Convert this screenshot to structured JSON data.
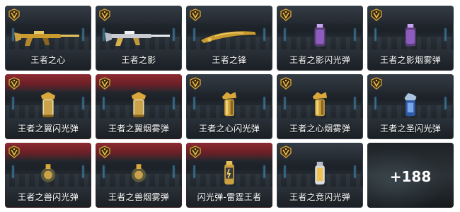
{
  "items": [
    {
      "name": "王者之心",
      "header": "gray",
      "art": "rifle"
    },
    {
      "name": "王者之影",
      "header": "gray",
      "art": "rifle-silver"
    },
    {
      "name": "王者之锋",
      "header": "gray",
      "art": "blade"
    },
    {
      "name": "王者之影闪光弹",
      "header": "gray",
      "art": "grenade-purple"
    },
    {
      "name": "王者之影烟雾弹",
      "header": "gray",
      "art": "grenade-purple"
    },
    {
      "name": "王者之翼闪光弹",
      "header": "red",
      "art": "canister-gold"
    },
    {
      "name": "王者之翼烟雾弹",
      "header": "red",
      "art": "canister-gold"
    },
    {
      "name": "王者之心闪光弹",
      "header": "gray",
      "art": "canister-dragon"
    },
    {
      "name": "王者之心烟雾弹",
      "header": "gray",
      "art": "canister-dragon"
    },
    {
      "name": "王者之圣闪光弹",
      "header": "gray",
      "art": "canister-blue"
    },
    {
      "name": "王者之兽闪光弹",
      "header": "red",
      "art": "grenade-round"
    },
    {
      "name": "王者之兽烟雾弹",
      "header": "red",
      "art": "grenade-round"
    },
    {
      "name": "闪光弹-雷霆王者",
      "header": "red",
      "art": "grenade-thunder"
    },
    {
      "name": "王者之竞闪光弹",
      "header": "gray",
      "art": "canister-white"
    }
  ],
  "more": {
    "count": "+188"
  },
  "colors": {
    "badge_gold": "#d9a73a",
    "header_red": "#8d2b32",
    "header_gray": "#343c45"
  }
}
